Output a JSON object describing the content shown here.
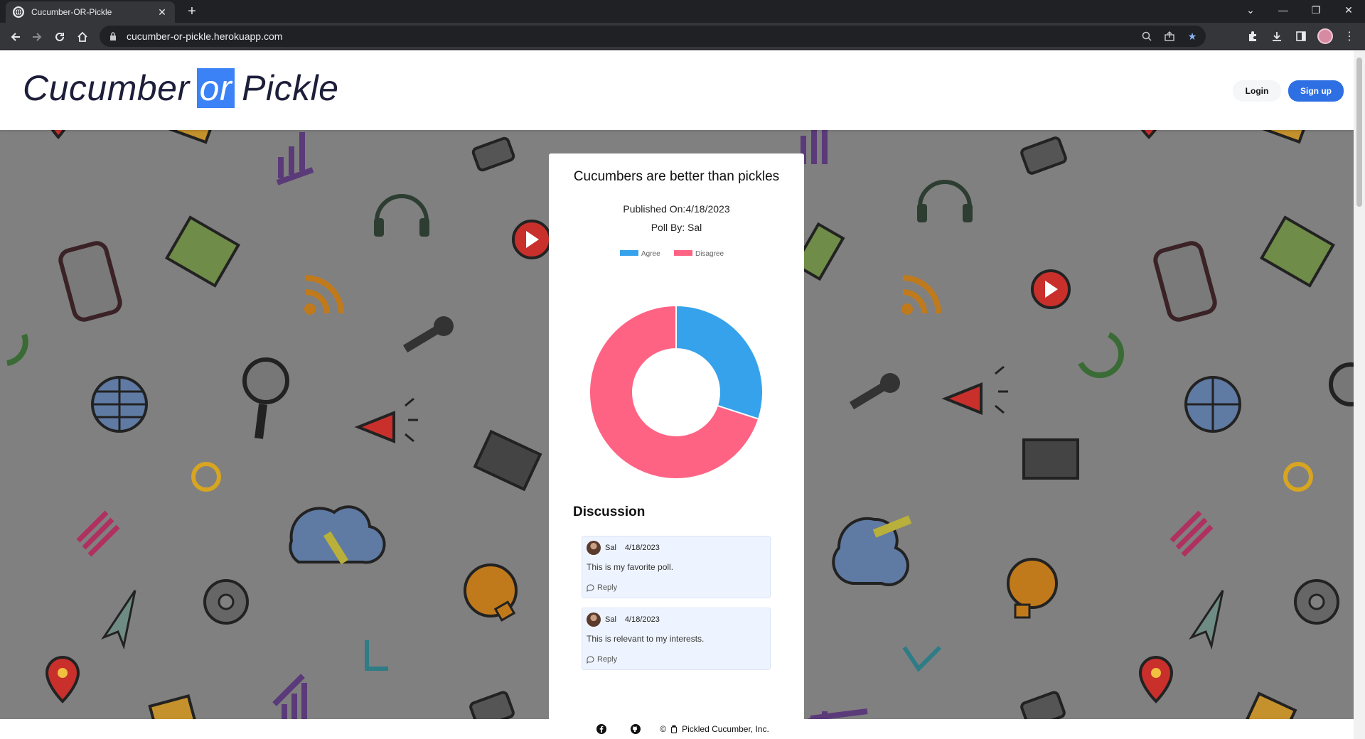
{
  "browser": {
    "tab_title": "Cucumber-OR-Pickle",
    "url": "cucumber-or-pickle.herokuapp.com"
  },
  "header": {
    "logo_part1": "Cucumber",
    "logo_part2": "or",
    "logo_part3": "Pickle",
    "login_label": "Login",
    "signup_label": "Sign up"
  },
  "poll": {
    "title": "Cucumbers are better than pickles",
    "published": "Published On:4/18/2023",
    "author": "Poll By: Sal"
  },
  "chart_data": {
    "type": "pie",
    "subtype": "doughnut",
    "legend_position": "top",
    "categories": [
      "Agree",
      "Disagree"
    ],
    "values": [
      30,
      70
    ],
    "colors": [
      "#36a2eb",
      "#ff6384"
    ]
  },
  "discussion": {
    "heading": "Discussion",
    "comments": [
      {
        "author": "Sal",
        "date": "4/18/2023",
        "text": "This is my favorite poll.",
        "reply_label": "Reply"
      },
      {
        "author": "Sal",
        "date": "4/18/2023",
        "text": "This is relevant to my interests.",
        "reply_label": "Reply"
      }
    ]
  },
  "footer": {
    "copyright_symbol": "©",
    "company": "Pickled Cucumber, Inc."
  },
  "icons": [
    "facebook-icon",
    "github-icon",
    "pickle-jar-icon"
  ],
  "theme": {
    "accent": "#2f6fe4",
    "logo_highlight": "#3b82f6"
  }
}
